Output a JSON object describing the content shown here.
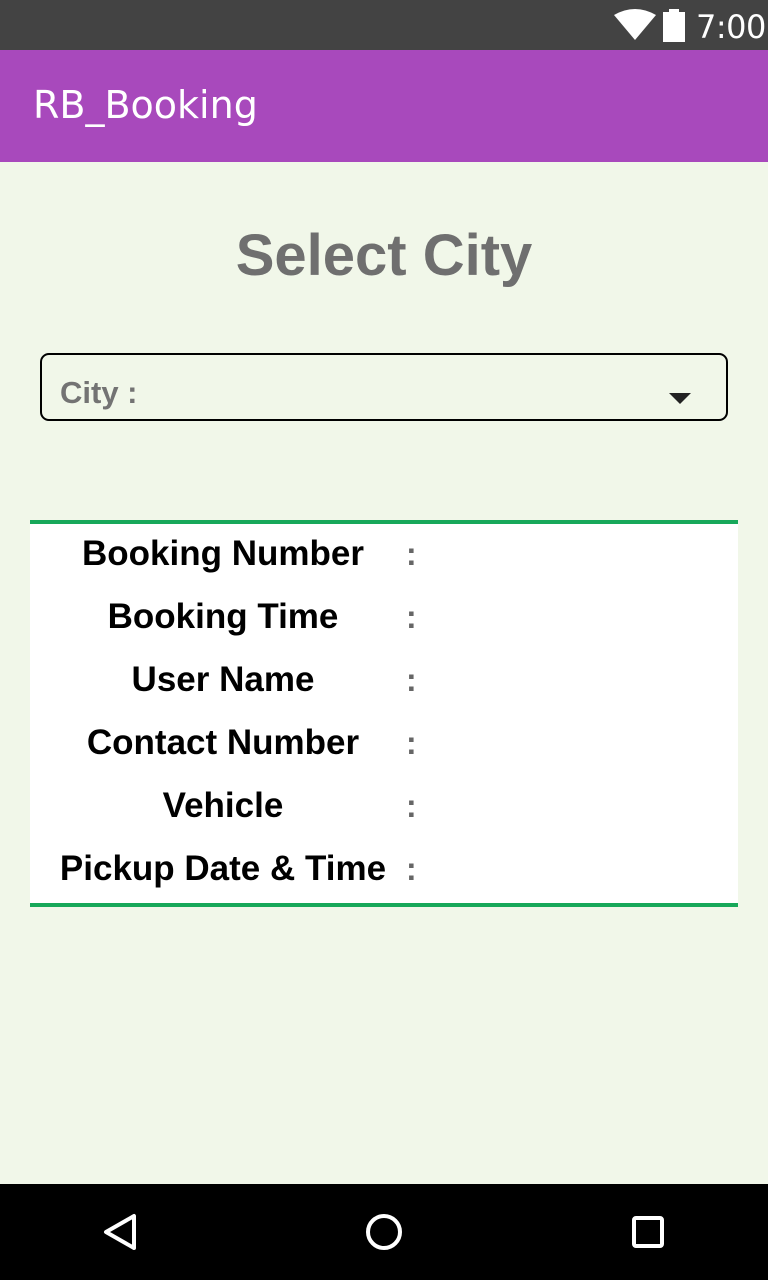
{
  "status_bar": {
    "time": "7:00",
    "icons": [
      "wifi-icon",
      "battery-icon"
    ]
  },
  "app_bar": {
    "title": "RB_Booking",
    "color": "#a849bc"
  },
  "main": {
    "heading": "Select City",
    "city_select": {
      "label": "City :",
      "selected_value": ""
    },
    "details": {
      "rows": [
        {
          "label": "Booking Number",
          "separator": ":",
          "value": ""
        },
        {
          "label": "Booking Time",
          "separator": ":",
          "value": ""
        },
        {
          "label": "User Name",
          "separator": ":",
          "value": ""
        },
        {
          "label": "Contact Number",
          "separator": ":",
          "value": ""
        },
        {
          "label": "Vehicle",
          "separator": ":",
          "value": ""
        },
        {
          "label": "Pickup Date & Time",
          "separator": ":",
          "value": ""
        }
      ],
      "border_color": "#17a85a"
    }
  },
  "nav_bar": {
    "buttons": [
      "back-icon",
      "home-icon",
      "recents-icon"
    ]
  }
}
